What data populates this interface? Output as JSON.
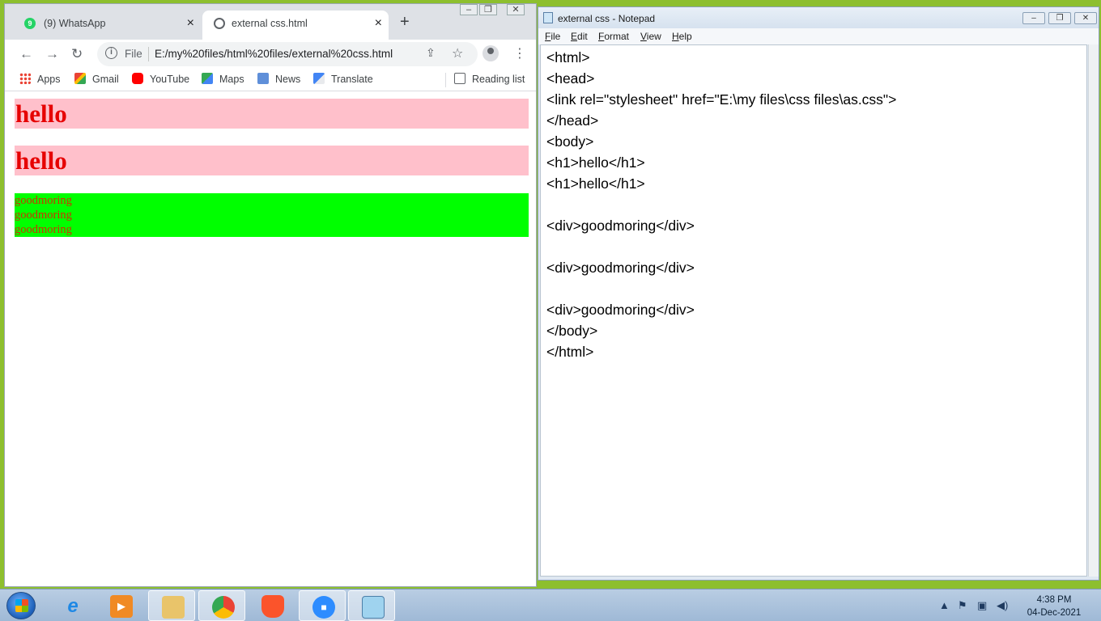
{
  "chrome": {
    "tabs": [
      {
        "label": "(9) WhatsApp",
        "badge": "9",
        "close": "×"
      },
      {
        "label": "external css.html",
        "close": "×"
      }
    ],
    "new_tab": "+",
    "address": {
      "file_label": "File",
      "url": "E:/my%20files/html%20files/external%20css.html"
    },
    "bookmarks": [
      {
        "label": "Apps",
        "icon": "apps-grid-icon"
      },
      {
        "label": "Gmail",
        "icon": "gmail-icon"
      },
      {
        "label": "YouTube",
        "icon": "youtube-icon"
      },
      {
        "label": "Maps",
        "icon": "maps-icon"
      },
      {
        "label": "News",
        "icon": "news-icon"
      },
      {
        "label": "Translate",
        "icon": "translate-icon"
      }
    ],
    "reading_list": "Reading list",
    "page": {
      "headings": [
        "hello",
        "hello"
      ],
      "divs": [
        "goodmoring",
        "goodmoring",
        "goodmoring"
      ]
    }
  },
  "notepad": {
    "title": "external css - Notepad",
    "menu": [
      {
        "key": "F",
        "rest": "ile"
      },
      {
        "key": "E",
        "rest": "dit"
      },
      {
        "key": "F",
        "rest": "ormat"
      },
      {
        "key": "V",
        "rest": "iew"
      },
      {
        "key": "H",
        "rest": "elp"
      }
    ],
    "lines": [
      "<html>",
      "<head>",
      "<link rel=\"stylesheet\" href=\"E:\\my files\\css files\\as.css\">",
      "</head>",
      "<body>",
      "<h1>hello</h1>",
      "<h1>hello</h1>",
      "",
      "<div>goodmoring</div>",
      "",
      "<div>goodmoring</div>",
      "",
      "<div>goodmoring</div>",
      "</body>",
      "</html>"
    ]
  },
  "taskbar": {
    "time": "4:38 PM",
    "date": "04-Dec-2021",
    "apps": [
      "internet-explorer-icon",
      "media-player-icon",
      "file-explorer-icon",
      "chrome-icon",
      "brave-icon",
      "zoom-icon",
      "notepad-icon"
    ]
  },
  "colors": {
    "h1_bg": "#ffc0cb",
    "h1_text": "#e60000",
    "div_bg": "#00ff00",
    "div_text": "#cc3300"
  }
}
